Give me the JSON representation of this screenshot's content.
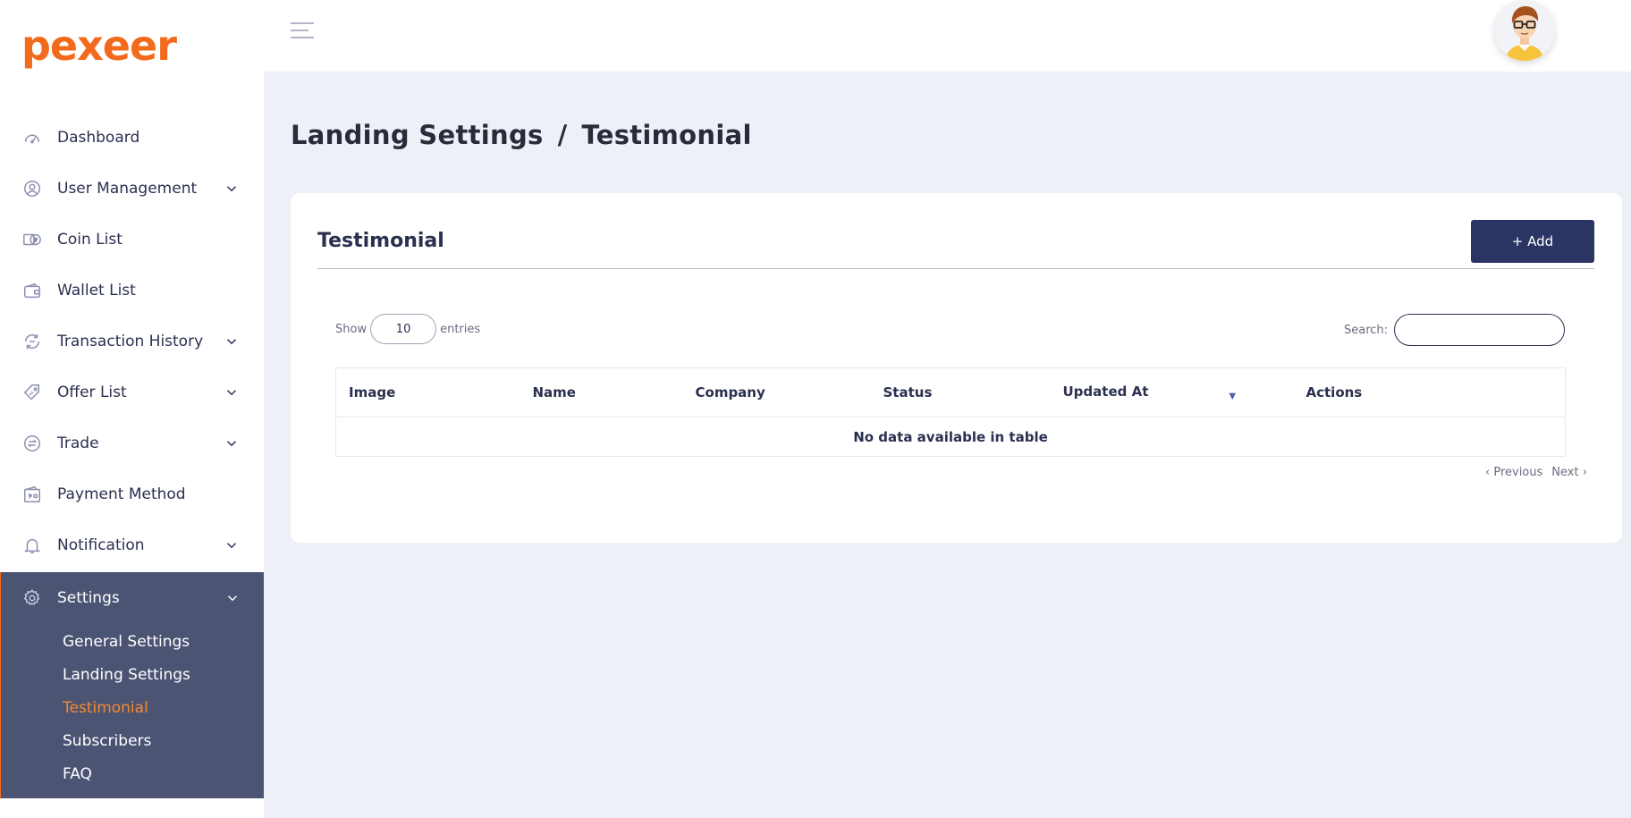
{
  "brand": {
    "logo_text": "pexeer",
    "accent_color": "#f26b1d"
  },
  "sidebar": {
    "items": [
      {
        "label": "Dashboard",
        "icon": "speedometer-icon",
        "has_submenu": false
      },
      {
        "label": "User Management",
        "icon": "user-icon",
        "has_submenu": true
      },
      {
        "label": "Coin List",
        "icon": "coins-icon",
        "has_submenu": false
      },
      {
        "label": "Wallet List",
        "icon": "wallet-icon",
        "has_submenu": false
      },
      {
        "label": "Transaction History",
        "icon": "transaction-icon",
        "has_submenu": true
      },
      {
        "label": "Offer List",
        "icon": "tag-icon",
        "has_submenu": true
      },
      {
        "label": "Trade",
        "icon": "exchange-icon",
        "has_submenu": true
      },
      {
        "label": "Payment Method",
        "icon": "payment-icon",
        "has_submenu": false
      },
      {
        "label": "Notification",
        "icon": "bell-icon",
        "has_submenu": true
      }
    ],
    "settings": {
      "label": "Settings",
      "icon": "gear-icon",
      "submenu": [
        {
          "label": "General Settings",
          "active": false
        },
        {
          "label": "Landing Settings",
          "active": false
        },
        {
          "label": "Testimonial",
          "active": true
        },
        {
          "label": "Subscribers",
          "active": false
        },
        {
          "label": "FAQ",
          "active": false
        }
      ]
    }
  },
  "header": {
    "menu_icon": "hamburger-icon",
    "avatar_icon": "user-avatar"
  },
  "breadcrumb": {
    "parent": "Landing Settings",
    "separator": "/",
    "current": "Testimonial"
  },
  "card": {
    "title": "Testimonial",
    "add_button": "+ Add",
    "show_label": "Show",
    "entries_value": "10",
    "entries_label": "entries",
    "search_label": "Search:",
    "search_value": ""
  },
  "table": {
    "columns": [
      "Image",
      "Name",
      "Company",
      "Status",
      "Updated At",
      "Actions"
    ],
    "empty_message": "No data available in table"
  },
  "pagination": {
    "previous": "‹ Previous",
    "next": "Next ›"
  }
}
